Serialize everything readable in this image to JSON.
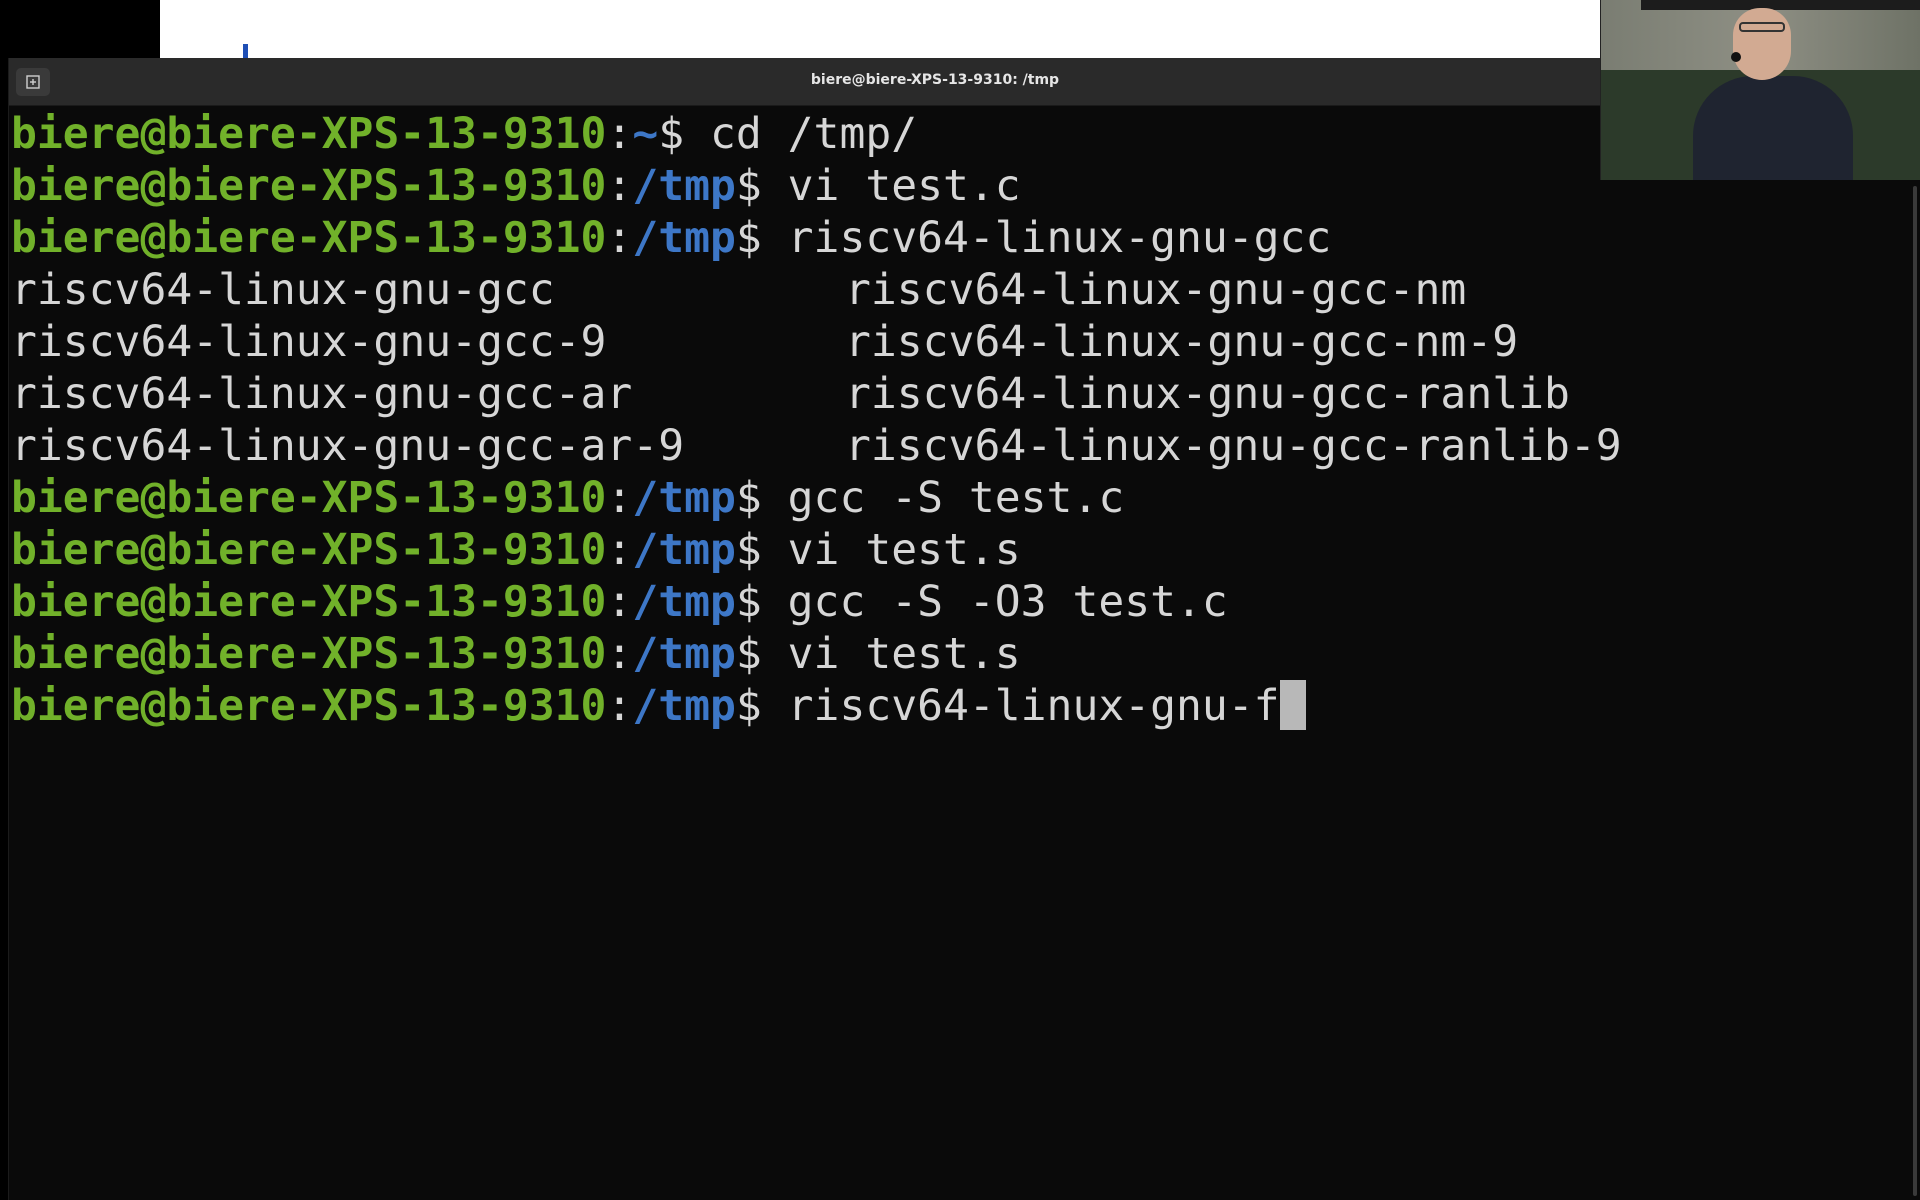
{
  "window": {
    "title": "biere@biere-XPS-13-9310: /tmp",
    "new_tab_icon": "new-tab-icon"
  },
  "prompt": {
    "user": "biere@biere-XPS-13-9310",
    "separator": ":",
    "dollar": "$ "
  },
  "terminal": {
    "lines": [
      {
        "type": "prompt",
        "path": "~",
        "command": "cd /tmp/"
      },
      {
        "type": "prompt",
        "path": "/tmp",
        "command": "vi test.c"
      },
      {
        "type": "prompt",
        "path": "/tmp",
        "command": "riscv64-linux-gnu-gcc"
      },
      {
        "type": "output",
        "col1": "riscv64-linux-gnu-gcc",
        "col2": "riscv64-linux-gnu-gcc-nm"
      },
      {
        "type": "output",
        "col1": "riscv64-linux-gnu-gcc-9",
        "col2": "riscv64-linux-gnu-gcc-nm-9"
      },
      {
        "type": "output",
        "col1": "riscv64-linux-gnu-gcc-ar",
        "col2": "riscv64-linux-gnu-gcc-ranlib"
      },
      {
        "type": "output",
        "col1": "riscv64-linux-gnu-gcc-ar-9",
        "col2": "riscv64-linux-gnu-gcc-ranlib-9"
      },
      {
        "type": "prompt",
        "path": "/tmp",
        "command": "gcc -S test.c"
      },
      {
        "type": "prompt",
        "path": "/tmp",
        "command": "vi test.s"
      },
      {
        "type": "prompt",
        "path": "/tmp",
        "command": "gcc -S -O3 test.c"
      },
      {
        "type": "prompt",
        "path": "/tmp",
        "command": "vi test.s"
      },
      {
        "type": "prompt",
        "path": "/tmp",
        "command": "riscv64-linux-gnu-f",
        "cursor": true
      }
    ]
  },
  "colors": {
    "user": "#71b12a",
    "path": "#3d77c7",
    "text": "#d6d6d6",
    "background": "#0a0a0a",
    "titlebar": "#2a2a2a"
  }
}
